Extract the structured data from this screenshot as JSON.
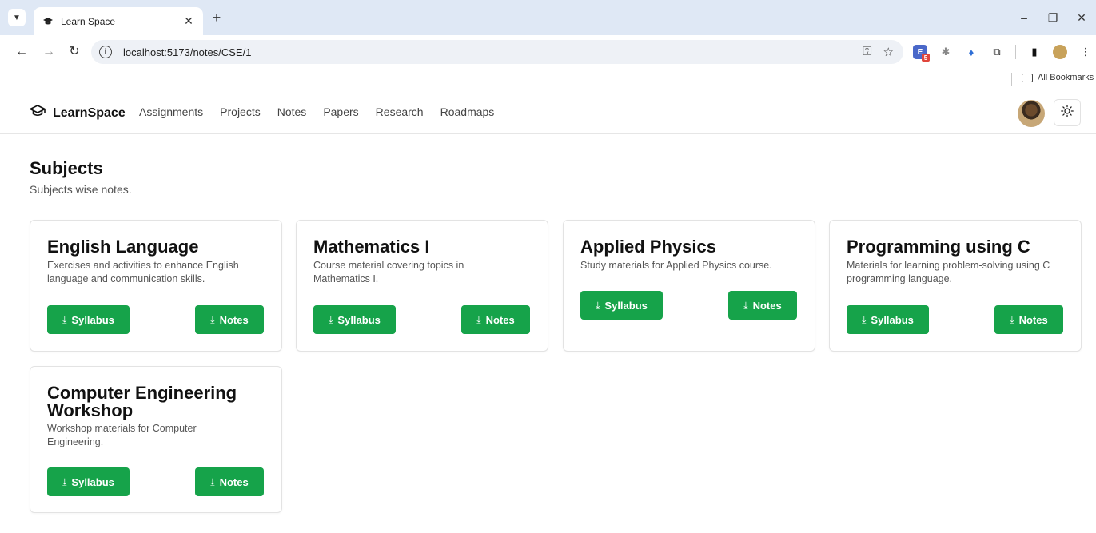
{
  "browser": {
    "tab_title": "Learn Space",
    "url": "localhost:5173/notes/CSE/1",
    "bookmarks_label": "All Bookmarks"
  },
  "app": {
    "brand": "LearnSpace",
    "nav": [
      "Assignments",
      "Projects",
      "Notes",
      "Papers",
      "Research",
      "Roadmaps"
    ]
  },
  "page": {
    "title": "Subjects",
    "subtitle": "Subjects wise notes."
  },
  "cards": [
    {
      "title": "English Language",
      "description": "Exercises and activities to enhance English language and communication skills.",
      "syllabus_label": "Syllabus",
      "notes_label": "Notes"
    },
    {
      "title": "Mathematics I",
      "description": "Course material covering topics in Mathematics I.",
      "syllabus_label": "Syllabus",
      "notes_label": "Notes"
    },
    {
      "title": "Applied Physics",
      "description": "Study materials for Applied Physics course.",
      "syllabus_label": "Syllabus",
      "notes_label": "Notes"
    },
    {
      "title": "Programming using C",
      "description": "Materials for learning problem-solving using C programming language.",
      "syllabus_label": "Syllabus",
      "notes_label": "Notes"
    },
    {
      "title": "Computer Engineering Workshop",
      "description": "Workshop materials for Computer Engineering.",
      "syllabus_label": "Syllabus",
      "notes_label": "Notes"
    }
  ],
  "colors": {
    "accent": "#16a34a",
    "chrome": "#dfe8f5"
  },
  "icons": {
    "brand": "graduation-cap-icon",
    "buttons": "download-icon",
    "theme": "sun-icon"
  }
}
